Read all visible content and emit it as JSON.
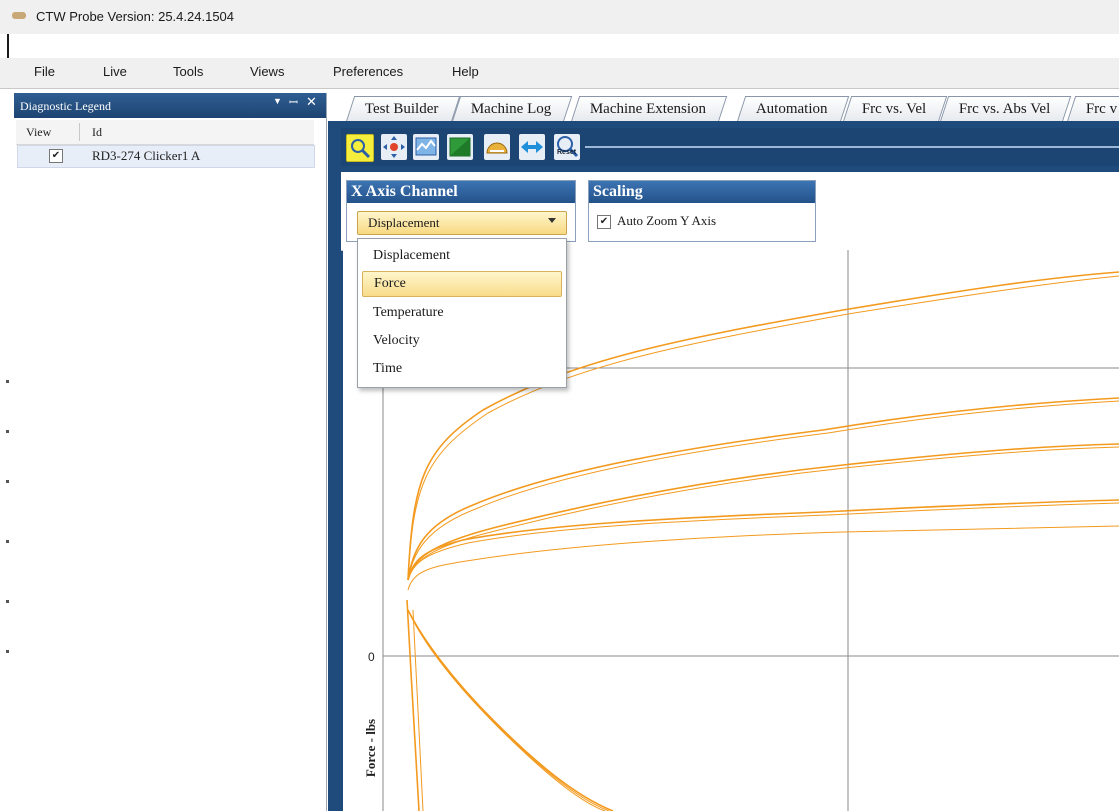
{
  "window": {
    "title": "CTW Probe Version: 25.4.24.1504"
  },
  "menu": [
    "File",
    "Live",
    "Tools",
    "Views",
    "Preferences",
    "Help"
  ],
  "legend": {
    "title": "Diagnostic Legend",
    "columns": {
      "view": "View",
      "id": "Id"
    },
    "rows": [
      {
        "checked": "✔",
        "id": "RD3-274 Clicker1 A"
      }
    ]
  },
  "tabs": [
    "Test Builder",
    "Machine Log",
    "Machine Extension",
    "Automation",
    "Frc vs. Vel",
    "Frc vs. Abs Vel",
    "Frc v"
  ],
  "toolbar": {
    "tools": [
      "zoom-icon",
      "pan-icon",
      "chart-icon",
      "fill-icon",
      "gauge-icon",
      "fit-width-icon",
      "reset-zoom-icon"
    ],
    "reset_label": "Reset"
  },
  "x_axis_channel": {
    "header": "X Axis Channel",
    "selected": "Displacement",
    "options": [
      "Displacement",
      "Force",
      "Temperature",
      "Velocity",
      "Time"
    ],
    "highlighted": "Force"
  },
  "scaling": {
    "header": "Scaling",
    "auto_zoom_label": "Auto Zoom Y Axis",
    "auto_zoom_checked": "✔"
  },
  "plot": {
    "y_zero_label": "0",
    "y_axis_label": "Force - lbs",
    "series_color": "#f39a1e"
  }
}
